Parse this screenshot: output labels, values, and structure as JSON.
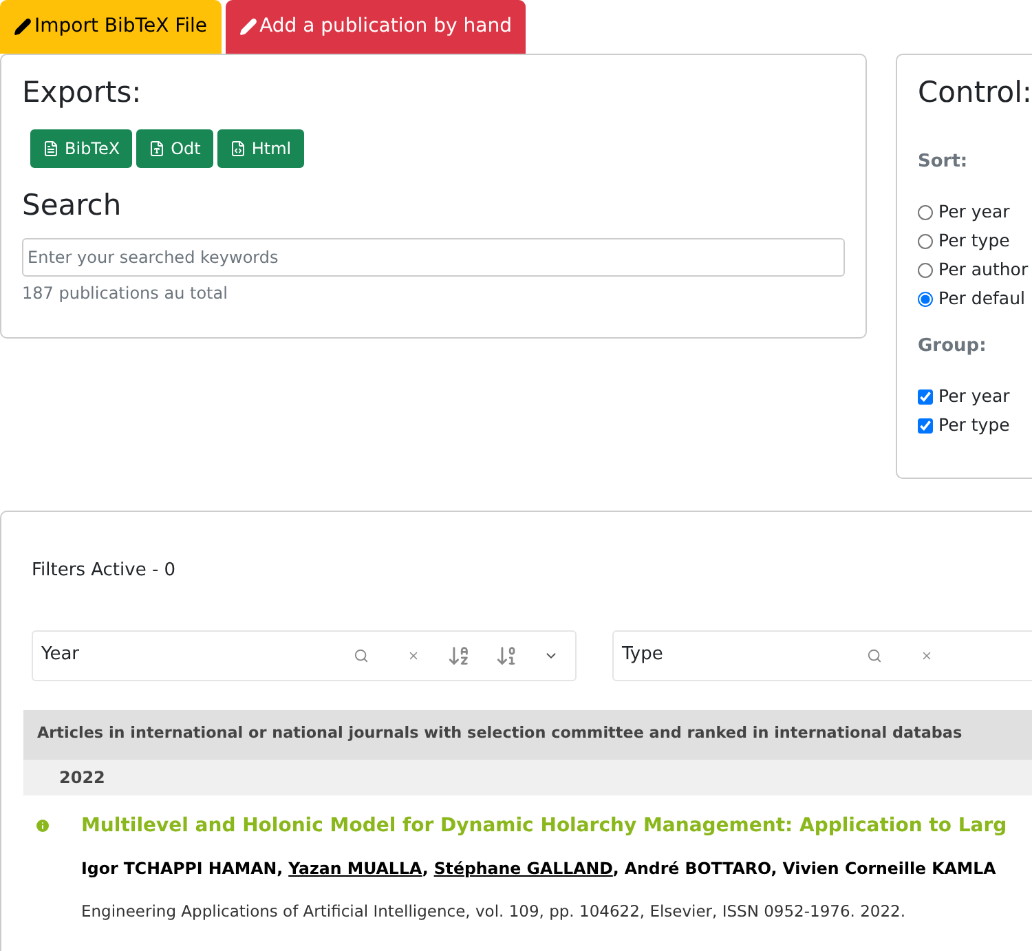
{
  "toolbar": [
    {
      "label": "Import BibTeX File",
      "kind": "warning"
    },
    {
      "label": "Add a publication by hand",
      "kind": "danger"
    }
  ],
  "exports": {
    "title": "Exports:",
    "buttons": [
      {
        "label": "BibTeX",
        "kind": "bib"
      },
      {
        "label": "Odt",
        "kind": "odt"
      },
      {
        "label": "Html",
        "kind": "html"
      }
    ]
  },
  "search": {
    "title": "Search",
    "placeholder": "Enter your searched keywords",
    "count": "187 publications au total"
  },
  "control": {
    "title": "Control:",
    "sort_label": "Sort:",
    "sort": [
      {
        "label": "Per year",
        "selected": false
      },
      {
        "label": "Per type",
        "selected": false
      },
      {
        "label": "Per author",
        "selected": false
      },
      {
        "label": "Per defaul",
        "selected": true
      }
    ],
    "group_label": "Group:",
    "group": [
      {
        "label": "Per year",
        "checked": true
      },
      {
        "label": "Per type",
        "checked": true
      }
    ]
  },
  "filters": {
    "status": "Filters Active - 0",
    "boxes": [
      {
        "label": "Year",
        "full": true
      },
      {
        "label": "Type",
        "full": false
      }
    ]
  },
  "category": "Articles in international or national journals with selection committee and ranked in international databas",
  "year": "2022",
  "publication": {
    "title": "Multilevel and Holonic Model for Dynamic Holarchy Management: Application to Larg",
    "authors": [
      {
        "name": "Igor TCHAPPI HAMAN",
        "underlined": false,
        "separator": ","
      },
      {
        "name": "Yazan MUALLA",
        "underlined": true,
        "separator": ","
      },
      {
        "name": "Stéphane GALLAND",
        "underlined": true,
        "separator": ","
      },
      {
        "name": "André BOTTARO",
        "underlined": false,
        "separator": ","
      },
      {
        "name": "Vivien Corneille KAMLA",
        "underlined": false
      }
    ],
    "venue": "Engineering Applications of Artificial Intelligence, vol. 109, pp. 104622, Elsevier, ISSN 0952-1976. 2022."
  }
}
